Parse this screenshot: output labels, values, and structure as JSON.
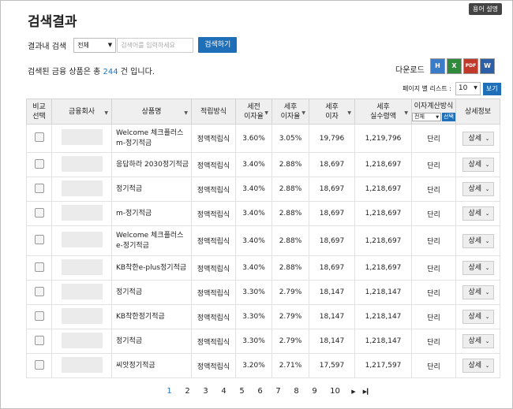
{
  "glossary_button": "용어 설명",
  "title": "검색결과",
  "search": {
    "label": "결과내 검색",
    "select_value": "전체",
    "placeholder": "검색어를 입력하세요",
    "button": "검색하기"
  },
  "result": {
    "prefix": "검색된 금융 상품은 총 ",
    "count": "244",
    "suffix": " 건 입니다."
  },
  "download": {
    "label": "다운로드",
    "icons": [
      {
        "name": "hwp-download-icon",
        "glyph": "H"
      },
      {
        "name": "excel-download-icon",
        "glyph": "X"
      },
      {
        "name": "pdf-download-icon",
        "glyph": "PDF"
      },
      {
        "name": "word-download-icon",
        "glyph": "W"
      }
    ]
  },
  "perpage": {
    "label": "페이지 별 리스트 :",
    "value": "10",
    "button": "보기"
  },
  "table": {
    "headers": {
      "compare": [
        "비교",
        "선택"
      ],
      "company": "금융회사",
      "product": "상품명",
      "method": "적립방식",
      "pre_tax_rate": [
        "세전",
        "이자율"
      ],
      "post_tax_rate": [
        "세후",
        "이자율"
      ],
      "post_tax_interest": [
        "세후",
        "이자"
      ],
      "post_tax_amount": [
        "세후",
        "실수령액"
      ],
      "calc_method": "이자계산방식",
      "calc_select": "전체",
      "calc_btn": "선택",
      "detail": "상세정보"
    },
    "rows": [
      {
        "product": "Welcome 체크플러스m-정기적금",
        "method": "정액적립식",
        "pre": "3.60%",
        "post": "3.05%",
        "interest": "19,796",
        "amount": "1,219,796",
        "calc": "단리",
        "detail": "상세"
      },
      {
        "product": "응답하라 2030정기적금",
        "method": "정액적립식",
        "pre": "3.40%",
        "post": "2.88%",
        "interest": "18,697",
        "amount": "1,218,697",
        "calc": "단리",
        "detail": "상세"
      },
      {
        "product": "정기적금",
        "method": "정액적립식",
        "pre": "3.40%",
        "post": "2.88%",
        "interest": "18,697",
        "amount": "1,218,697",
        "calc": "단리",
        "detail": "상세"
      },
      {
        "product": "m-정기적금",
        "method": "정액적립식",
        "pre": "3.40%",
        "post": "2.88%",
        "interest": "18,697",
        "amount": "1,218,697",
        "calc": "단리",
        "detail": "상세"
      },
      {
        "product": "Welcome 체크플러스 e-정기적금",
        "method": "정액적립식",
        "pre": "3.40%",
        "post": "2.88%",
        "interest": "18,697",
        "amount": "1,218,697",
        "calc": "단리",
        "detail": "상세"
      },
      {
        "product": "KB착한e-plus정기적금",
        "method": "정액적립식",
        "pre": "3.40%",
        "post": "2.88%",
        "interest": "18,697",
        "amount": "1,218,697",
        "calc": "단리",
        "detail": "상세"
      },
      {
        "product": "정기적금",
        "method": "정액적립식",
        "pre": "3.30%",
        "post": "2.79%",
        "interest": "18,147",
        "amount": "1,218,147",
        "calc": "단리",
        "detail": "상세"
      },
      {
        "product": "KB착한정기적금",
        "method": "정액적립식",
        "pre": "3.30%",
        "post": "2.79%",
        "interest": "18,147",
        "amount": "1,218,147",
        "calc": "단리",
        "detail": "상세"
      },
      {
        "product": "정기적금",
        "method": "정액적립식",
        "pre": "3.30%",
        "post": "2.79%",
        "interest": "18,147",
        "amount": "1,218,147",
        "calc": "단리",
        "detail": "상세"
      },
      {
        "product": "씨앗정기적금",
        "method": "정액적립식",
        "pre": "3.20%",
        "post": "2.71%",
        "interest": "17,597",
        "amount": "1,217,597",
        "calc": "단리",
        "detail": "상세"
      }
    ]
  },
  "pagination": {
    "pages": [
      "1",
      "2",
      "3",
      "4",
      "5",
      "6",
      "7",
      "8",
      "9",
      "10"
    ],
    "current": "1",
    "next": "▶",
    "last": "▶▎"
  },
  "colors": {
    "accent": "#1f6fb8",
    "count": "#1a74c4",
    "current_page": "#1a74c4"
  }
}
